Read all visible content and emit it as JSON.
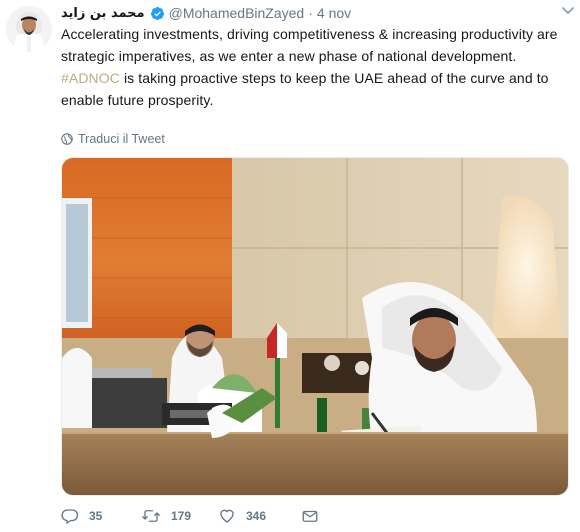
{
  "tweet": {
    "display_name": "محمد بن زايد",
    "handle": "@MohamedBinZayed",
    "separator": "·",
    "time": "4 nov",
    "paragraph1": "Accelerating investments, driving competitiveness & increasing productivity are strategic imperatives, as we enter a new phase of national development.",
    "hashtag": "#ADNOC",
    "paragraph2_rest": " is taking proactive steps to keep the UAE ahead of the curve and to enable future prosperity.",
    "translate_label": "Traduci il Tweet"
  },
  "actions": {
    "replies": "35",
    "retweets": "179",
    "likes": "346"
  },
  "icons": {
    "verified": "verified-badge-icon",
    "caret": "chevron-down-icon",
    "globe": "globe-icon",
    "reply": "reply-icon",
    "retweet": "retweet-icon",
    "like": "heart-icon",
    "message": "envelope-icon"
  },
  "colors": {
    "verified": "#1da1f2",
    "hashtag": "#c3aa82",
    "muted": "#657786",
    "text": "#14171a"
  }
}
